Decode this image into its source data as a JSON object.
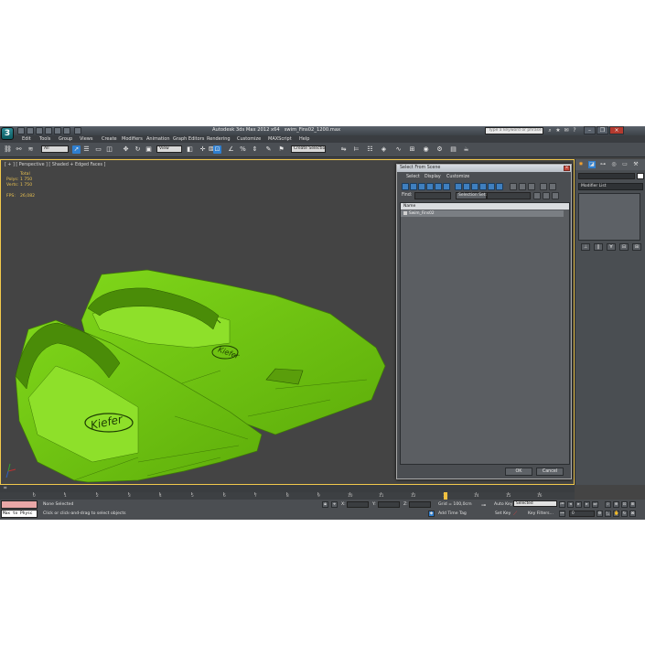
{
  "window": {
    "title": "Autodesk 3ds Max 2012 x64",
    "file": "swim_Fins02_1200.max",
    "search_placeholder": "Type a keyword or phrase",
    "logo": "3ds-max-logo-icon"
  },
  "menu": {
    "items": [
      "Edit",
      "Tools",
      "Group",
      "Views",
      "Create",
      "Modifiers",
      "Animation",
      "Graph Editors",
      "Rendering",
      "Customize",
      "MAXScript",
      "Help"
    ]
  },
  "toolbar": {
    "selection_filter": "All",
    "reference_coord": "View",
    "named_selection": "Create Selection Se"
  },
  "viewport": {
    "label": "[ + ] [ Perspective ] [ Shaded + Edged Faces ]",
    "stats": {
      "header": "Total",
      "polys_label": "Polys:",
      "polys_value": "1 750",
      "verts_label": "Verts:",
      "verts_value": "1 750",
      "fps_label": "FPS:",
      "fps_value": "26,082"
    },
    "model_color": "#6fc40f",
    "background_color": "#444444"
  },
  "command_panel": {
    "modifier_list": "Modifier List",
    "object_color": "#ffffff"
  },
  "dialog": {
    "title": "Select From Scene",
    "menu": [
      "Select",
      "Display",
      "Customize"
    ],
    "find_label": "Find:",
    "selection_set_label": "Selection Set:",
    "column_name": "Name",
    "objects": [
      "Swim_Fins02"
    ],
    "ok_label": "OK",
    "cancel_label": "Cancel"
  },
  "timeline": {
    "position": "0 / 100",
    "ticks": [
      "0",
      "1",
      "2",
      "3",
      "4",
      "5",
      "6",
      "7",
      "8",
      "9",
      "10",
      "11",
      "12",
      "13",
      "14",
      "15",
      "16"
    ]
  },
  "statusbar": {
    "maxscript_output": "Max to Physc",
    "selection_status": "None Selected",
    "prompt": "Click or click-and-drag to select objects",
    "x_label": "X:",
    "y_label": "Y:",
    "z_label": "Z:",
    "grid": "Grid = 100,0cm",
    "add_time_tag": "Add Time Tag",
    "auto_key": "Auto Key",
    "auto_key_mode": "Selected",
    "set_key": "Set Key",
    "key_filters": "Key Filters...",
    "frame": "0"
  }
}
